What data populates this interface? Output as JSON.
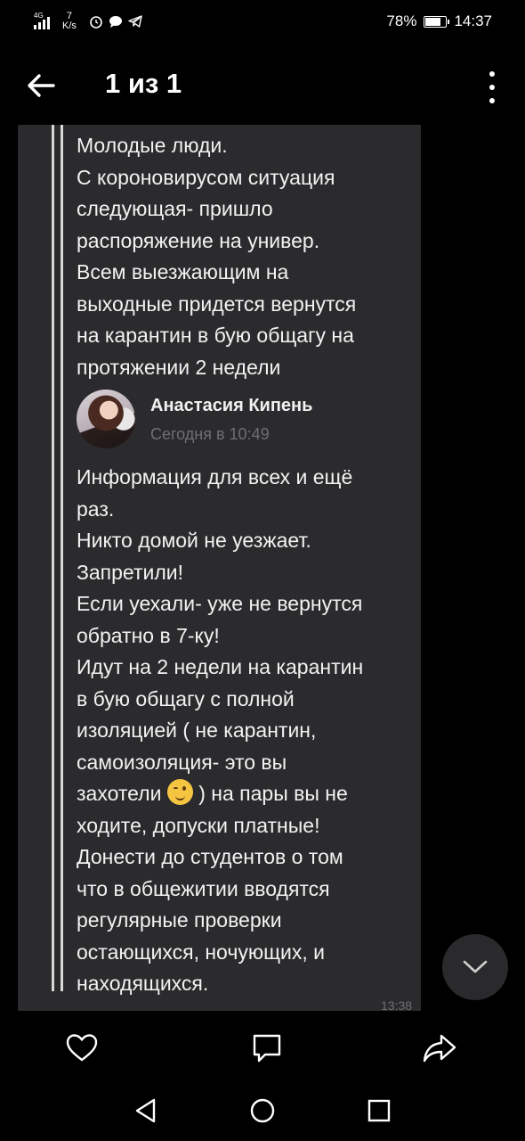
{
  "status_bar": {
    "network": "4G",
    "speed_value": "7",
    "speed_unit": "K/s",
    "battery_percent": "78%",
    "battery_level": 0.78,
    "time": "14:37"
  },
  "header": {
    "title": "1 из 1",
    "back_icon": "arrow-left-icon",
    "menu_icon": "more-vertical-icon"
  },
  "message": {
    "quoted_text": "Молодые люди.\nС короновирусом ситуация\nследующая- пришло\nраспоряжение на универ.\nВсем выезжающим на\nвыходные придется вернутся\nна карантин в бую общагу на\nпротяжении 2 недели",
    "author_name": "Анастасия Кипень",
    "author_time": "Сегодня в 10:49",
    "body_before_emoji": "Информация для всех и ещё\nраз.\nНикто домой не уезжает.\nЗапретили!\nЕсли уехали- уже  не вернутся\nобратно в 7-ку!\nИдут на 2 недели на карантин\nв бую общагу с полной\nизоляцией ( не карантин,\nсамоизоляция- это вы\nзахотели ",
    "body_after_emoji": " ) на пары вы не\nходите, допуски платные!\nДонести до студентов о том\nчто в общежитии вводятся\nрегулярные проверки\nостающихся, ночующих,  и\nнаходящихся.",
    "emoji": "winking-face-emoji",
    "time": "13:38"
  },
  "actions": {
    "like_icon": "heart-icon",
    "comment_icon": "comment-icon",
    "share_icon": "share-icon"
  },
  "nav": {
    "back_icon": "triangle-back-icon",
    "home_icon": "circle-home-icon",
    "recent_icon": "square-recent-icon"
  },
  "colors": {
    "background": "#000000",
    "bubble": "#2b2b2d",
    "text": "#f2f2f2",
    "muted": "#6f6f72"
  }
}
